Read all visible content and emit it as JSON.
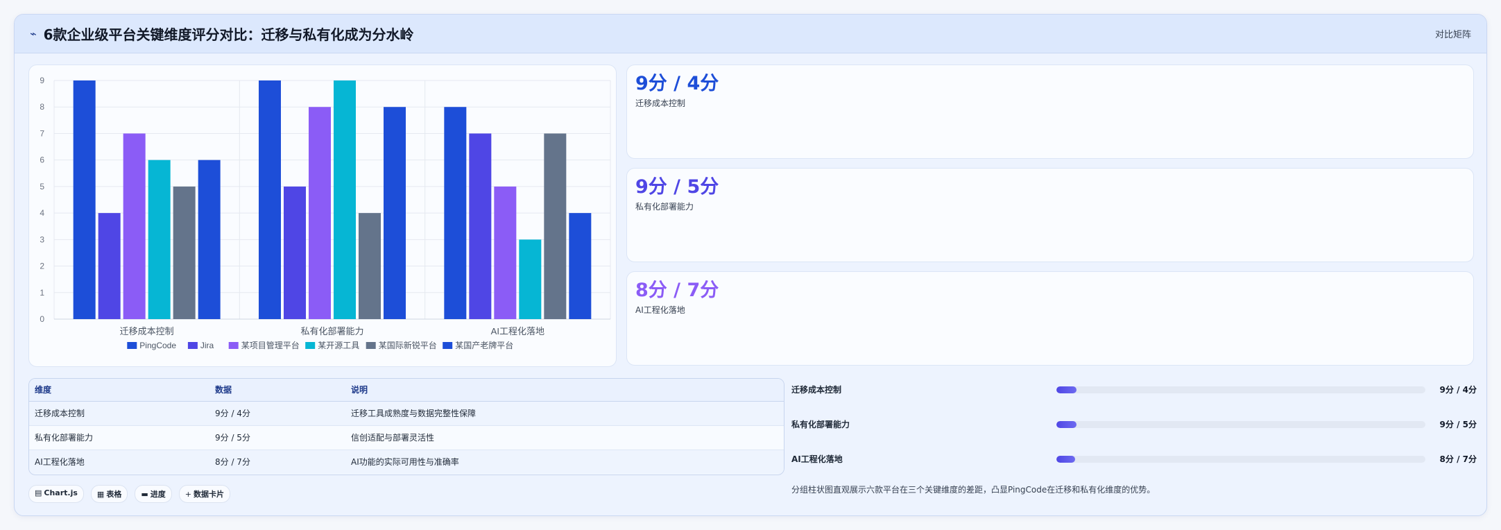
{
  "header": {
    "icon": "trend-icon",
    "title": "6款企业级平台关键维度评分对比：迁移与私有化成为分水岭",
    "badge": "对比矩阵"
  },
  "chart_data": {
    "type": "bar",
    "categories": [
      "迁移成本控制",
      "私有化部署能力",
      "AI工程化落地"
    ],
    "ylim": [
      0,
      9
    ],
    "yticks": [
      "0",
      "1",
      "2",
      "3",
      "4",
      "5",
      "6",
      "7",
      "8",
      "9"
    ],
    "grid": true,
    "legend_position": "bottom",
    "series": [
      {
        "name": "PingCode",
        "color": "#1d4ed8",
        "values": [
          9,
          9,
          8
        ]
      },
      {
        "name": "Jira",
        "color": "#4f46e5",
        "values": [
          4,
          5,
          7
        ]
      },
      {
        "name": "某项目管理平台",
        "color": "#8b5cf6",
        "values": [
          7,
          8,
          5
        ]
      },
      {
        "name": "某开源工具",
        "color": "#06b6d4",
        "values": [
          6,
          9,
          3
        ]
      },
      {
        "name": "某国际新锐平台",
        "color": "#64748b",
        "values": [
          5,
          4,
          7
        ]
      },
      {
        "name": "某国产老牌平台",
        "color": "#1d4ed8",
        "values": [
          6,
          8,
          4
        ]
      }
    ]
  },
  "stats": [
    {
      "value": "9分 / 4分",
      "label": "迁移成本控制",
      "color": "#1d4ed8"
    },
    {
      "value": "9分 / 5分",
      "label": "私有化部署能力",
      "color": "#4f46e5"
    },
    {
      "value": "8分 / 7分",
      "label": "AI工程化落地",
      "color": "#8b5cf6"
    }
  ],
  "table": {
    "headers": [
      "维度",
      "数据",
      "说明"
    ],
    "rows": [
      [
        "迁移成本控制",
        "9分 / 4分",
        "迁移工具成熟度与数据完整性保障"
      ],
      [
        "私有化部署能力",
        "9分 / 5分",
        "信创适配与部署灵活性"
      ],
      [
        "AI工程化落地",
        "8分 / 7分",
        "AI功能的实际可用性与准确率"
      ]
    ]
  },
  "tags": [
    {
      "icon": "chart-icon",
      "glyph": "▤",
      "label": "Chart.js"
    },
    {
      "icon": "table-icon",
      "glyph": "▦",
      "label": "表格"
    },
    {
      "icon": "progress-icon",
      "glyph": "▬",
      "label": "进度"
    },
    {
      "icon": "plus-icon",
      "glyph": "+",
      "label": "数据卡片"
    }
  ],
  "progress": [
    {
      "label": "迁移成本控制",
      "value": "9分 / 4分",
      "fill_fraction": 0.055
    },
    {
      "label": "私有化部署能力",
      "value": "9分 / 5分",
      "fill_fraction": 0.055
    },
    {
      "label": "AI工程化落地",
      "value": "8分 / 7分",
      "fill_fraction": 0.05
    }
  ],
  "note": "分组柱状图直观展示六款平台在三个关键维度的差距，凸显PingCode在迁移和私有化维度的优势。"
}
